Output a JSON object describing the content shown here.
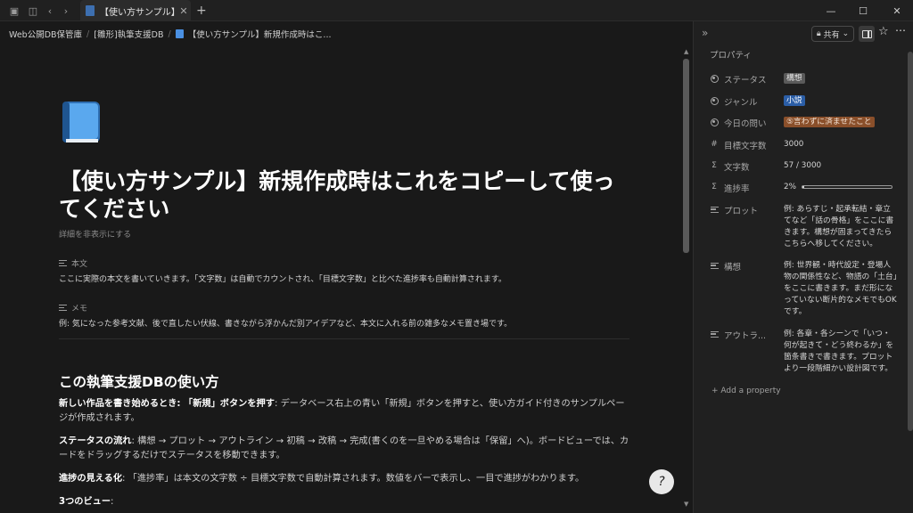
{
  "tab": {
    "title": "【使い方サンプル】新…"
  },
  "breadcrumb": [
    "Web公開DB保管庫",
    "[雛形]執筆支援DB",
    "【使い方サンプル】新規作成時はこ..."
  ],
  "page": {
    "title": "【使い方サンプル】新規作成時はこれをコピーして使ってください",
    "hide_details": "詳細を非表示にする",
    "fields": [
      {
        "label": "本文",
        "value": "ここに実際の本文を書いていきます。「文字数」は自動でカウントされ、「目標文字数」と比べた進捗率も自動計算されます。"
      },
      {
        "label": "メモ",
        "value": "例: 気になった参考文献、後で直したい伏線、書きながら浮かんだ別アイデアなど、本文に入れる前の雑多なメモ置き場です。"
      }
    ],
    "section_heading": "この執筆支援DBの使い方",
    "paragraphs": [
      {
        "lead": "新しい作品を書き始めるとき: 「新規」ボタンを押す",
        "body": ": データベース右上の青い「新規」ボタンを押すと、使い方ガイド付きのサンプルページが作成されます。"
      },
      {
        "lead": "ステータスの流れ",
        "body": ": 構想 → プロット → アウトライン → 初稿 → 改稿 → 完成(書くのを一旦やめる場合は「保留」へ)。ボードビューでは、カードをドラッグするだけでステータスを移動できます。"
      },
      {
        "lead": "進捗の見える化",
        "body": ": 「進捗率」は本文の文字数 ÷ 目標文字数で自動計算されます。数値をバーで表示し、一目で進捗がわかります。"
      },
      {
        "lead": "3つのビュー",
        "body": ":"
      }
    ]
  },
  "panel": {
    "share_label": "共有",
    "heading": "プロパティ",
    "add_property": "+ Add a property",
    "props": [
      {
        "label": "ステータス",
        "icon": "status-icon",
        "value": "構想",
        "tag_bg": "#5a5a5a",
        "tag_fg": "#e6e6e6"
      },
      {
        "label": "ジャンル",
        "icon": "select-icon",
        "value": "小説",
        "tag_bg": "#2b5ea7",
        "tag_fg": "#ffffff"
      },
      {
        "label": "今日の問い",
        "icon": "select-icon",
        "value": "⑤言わずに済ませたこと",
        "tag_bg": "#8a4f2a",
        "tag_fg": "#f3e2d4"
      },
      {
        "label": "目標文字数",
        "icon": "number-icon",
        "value": "3000"
      },
      {
        "label": "文字数",
        "icon": "formula-icon",
        "value": "57 / 3000"
      },
      {
        "label": "進捗率",
        "icon": "formula-icon",
        "value": "2%",
        "progress": 0.02
      },
      {
        "label": "プロット",
        "icon": "text-icon",
        "value": "例: あらすじ・起承転結・章立てなど「話の骨格」をここに書きます。構想が固まってきたらこちらへ移してください。"
      },
      {
        "label": "構想",
        "icon": "text-icon",
        "value": "例: 世界観・時代設定・登場人物の関係性など、物語の「土台」をここに書きます。まだ形になっていない断片的なメモでもOKです。"
      },
      {
        "label": "アウトラ...",
        "icon": "text-icon",
        "value": "例: 各章・各シーンで「いつ・何が起きて・どう終わるか」を箇条書きで書きます。プロットより一段階細かい設計図です。"
      }
    ]
  }
}
